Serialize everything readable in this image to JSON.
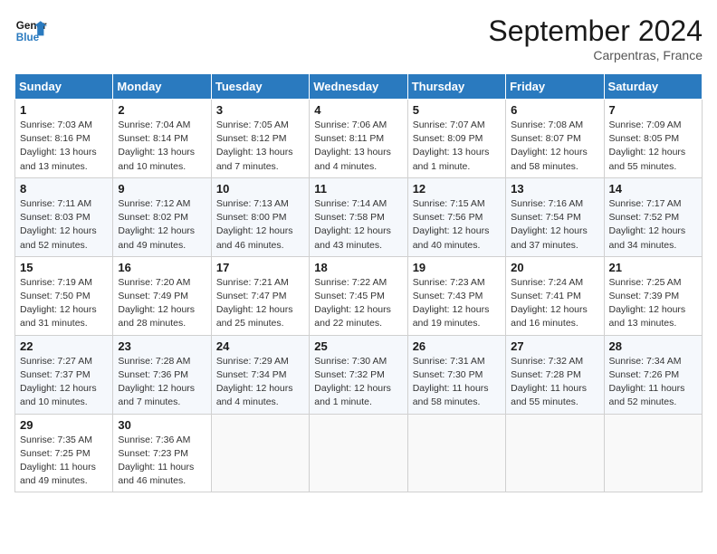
{
  "header": {
    "logo_line1": "General",
    "logo_line2": "Blue",
    "month": "September 2024",
    "location": "Carpentras, France"
  },
  "weekdays": [
    "Sunday",
    "Monday",
    "Tuesday",
    "Wednesday",
    "Thursday",
    "Friday",
    "Saturday"
  ],
  "weeks": [
    [
      {
        "day": "1",
        "info": "Sunrise: 7:03 AM\nSunset: 8:16 PM\nDaylight: 13 hours\nand 13 minutes."
      },
      {
        "day": "2",
        "info": "Sunrise: 7:04 AM\nSunset: 8:14 PM\nDaylight: 13 hours\nand 10 minutes."
      },
      {
        "day": "3",
        "info": "Sunrise: 7:05 AM\nSunset: 8:12 PM\nDaylight: 13 hours\nand 7 minutes."
      },
      {
        "day": "4",
        "info": "Sunrise: 7:06 AM\nSunset: 8:11 PM\nDaylight: 13 hours\nand 4 minutes."
      },
      {
        "day": "5",
        "info": "Sunrise: 7:07 AM\nSunset: 8:09 PM\nDaylight: 13 hours\nand 1 minute."
      },
      {
        "day": "6",
        "info": "Sunrise: 7:08 AM\nSunset: 8:07 PM\nDaylight: 12 hours\nand 58 minutes."
      },
      {
        "day": "7",
        "info": "Sunrise: 7:09 AM\nSunset: 8:05 PM\nDaylight: 12 hours\nand 55 minutes."
      }
    ],
    [
      {
        "day": "8",
        "info": "Sunrise: 7:11 AM\nSunset: 8:03 PM\nDaylight: 12 hours\nand 52 minutes."
      },
      {
        "day": "9",
        "info": "Sunrise: 7:12 AM\nSunset: 8:02 PM\nDaylight: 12 hours\nand 49 minutes."
      },
      {
        "day": "10",
        "info": "Sunrise: 7:13 AM\nSunset: 8:00 PM\nDaylight: 12 hours\nand 46 minutes."
      },
      {
        "day": "11",
        "info": "Sunrise: 7:14 AM\nSunset: 7:58 PM\nDaylight: 12 hours\nand 43 minutes."
      },
      {
        "day": "12",
        "info": "Sunrise: 7:15 AM\nSunset: 7:56 PM\nDaylight: 12 hours\nand 40 minutes."
      },
      {
        "day": "13",
        "info": "Sunrise: 7:16 AM\nSunset: 7:54 PM\nDaylight: 12 hours\nand 37 minutes."
      },
      {
        "day": "14",
        "info": "Sunrise: 7:17 AM\nSunset: 7:52 PM\nDaylight: 12 hours\nand 34 minutes."
      }
    ],
    [
      {
        "day": "15",
        "info": "Sunrise: 7:19 AM\nSunset: 7:50 PM\nDaylight: 12 hours\nand 31 minutes."
      },
      {
        "day": "16",
        "info": "Sunrise: 7:20 AM\nSunset: 7:49 PM\nDaylight: 12 hours\nand 28 minutes."
      },
      {
        "day": "17",
        "info": "Sunrise: 7:21 AM\nSunset: 7:47 PM\nDaylight: 12 hours\nand 25 minutes."
      },
      {
        "day": "18",
        "info": "Sunrise: 7:22 AM\nSunset: 7:45 PM\nDaylight: 12 hours\nand 22 minutes."
      },
      {
        "day": "19",
        "info": "Sunrise: 7:23 AM\nSunset: 7:43 PM\nDaylight: 12 hours\nand 19 minutes."
      },
      {
        "day": "20",
        "info": "Sunrise: 7:24 AM\nSunset: 7:41 PM\nDaylight: 12 hours\nand 16 minutes."
      },
      {
        "day": "21",
        "info": "Sunrise: 7:25 AM\nSunset: 7:39 PM\nDaylight: 12 hours\nand 13 minutes."
      }
    ],
    [
      {
        "day": "22",
        "info": "Sunrise: 7:27 AM\nSunset: 7:37 PM\nDaylight: 12 hours\nand 10 minutes."
      },
      {
        "day": "23",
        "info": "Sunrise: 7:28 AM\nSunset: 7:36 PM\nDaylight: 12 hours\nand 7 minutes."
      },
      {
        "day": "24",
        "info": "Sunrise: 7:29 AM\nSunset: 7:34 PM\nDaylight: 12 hours\nand 4 minutes."
      },
      {
        "day": "25",
        "info": "Sunrise: 7:30 AM\nSunset: 7:32 PM\nDaylight: 12 hours\nand 1 minute."
      },
      {
        "day": "26",
        "info": "Sunrise: 7:31 AM\nSunset: 7:30 PM\nDaylight: 11 hours\nand 58 minutes."
      },
      {
        "day": "27",
        "info": "Sunrise: 7:32 AM\nSunset: 7:28 PM\nDaylight: 11 hours\nand 55 minutes."
      },
      {
        "day": "28",
        "info": "Sunrise: 7:34 AM\nSunset: 7:26 PM\nDaylight: 11 hours\nand 52 minutes."
      }
    ],
    [
      {
        "day": "29",
        "info": "Sunrise: 7:35 AM\nSunset: 7:25 PM\nDaylight: 11 hours\nand 49 minutes."
      },
      {
        "day": "30",
        "info": "Sunrise: 7:36 AM\nSunset: 7:23 PM\nDaylight: 11 hours\nand 46 minutes."
      },
      {
        "day": "",
        "info": ""
      },
      {
        "day": "",
        "info": ""
      },
      {
        "day": "",
        "info": ""
      },
      {
        "day": "",
        "info": ""
      },
      {
        "day": "",
        "info": ""
      }
    ]
  ]
}
